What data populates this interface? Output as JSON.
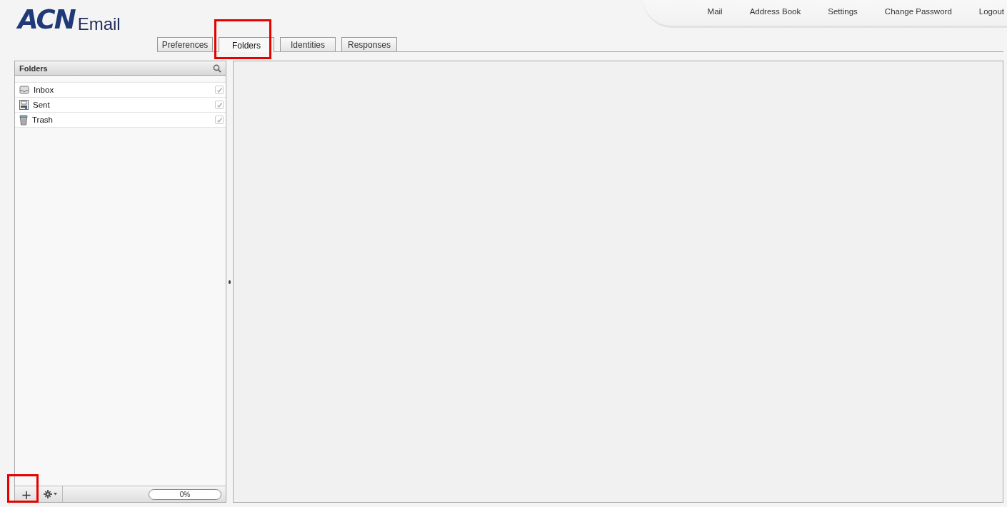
{
  "logo": {
    "brand": "ACN",
    "product": "Email"
  },
  "top_nav": [
    "Mail",
    "Address Book",
    "Settings",
    "Change Password",
    "Logout"
  ],
  "tabs": [
    {
      "label": "Preferences",
      "selected": false
    },
    {
      "label": "Folders",
      "selected": true
    },
    {
      "label": "Identities",
      "selected": false
    },
    {
      "label": "Responses",
      "selected": false
    }
  ],
  "folders_panel": {
    "title": "Folders",
    "folders": [
      {
        "name": "Inbox",
        "kind": "inbox",
        "subscribed": true
      },
      {
        "name": "Sent",
        "kind": "sent",
        "subscribed": true
      },
      {
        "name": "Trash",
        "kind": "trash",
        "subscribed": true
      }
    ],
    "add_button": "+",
    "quota": {
      "level": 0,
      "reading": "0%"
    }
  }
}
